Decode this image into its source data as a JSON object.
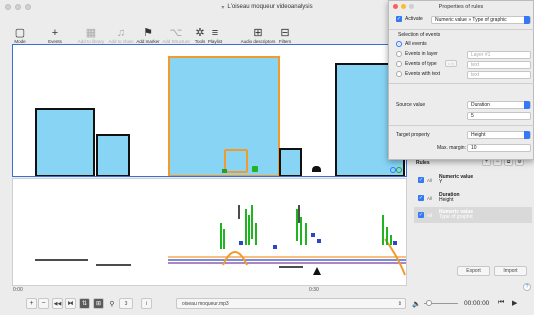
{
  "window": {
    "title": "L'oiseau moqueur videoanalysis"
  },
  "toolbar": {
    "items": [
      {
        "label": "Mode",
        "icon": "square-icon",
        "glyph": "▢",
        "enabled": true
      },
      {
        "label": "Events",
        "icon": "plus-icon",
        "glyph": "+",
        "enabled": true
      },
      {
        "label": "Add to library",
        "icon": "grid-icon",
        "glyph": "▦",
        "enabled": false
      },
      {
        "label": "Add to chain",
        "icon": "chain-icon",
        "glyph": "♫",
        "enabled": false
      },
      {
        "label": "Add marker",
        "icon": "flag-icon",
        "glyph": "⚑",
        "enabled": true
      },
      {
        "label": "Add Structure",
        "icon": "structure-icon",
        "glyph": "⌥",
        "enabled": false
      },
      {
        "label": "Tools",
        "icon": "gear-icon",
        "glyph": "✲",
        "enabled": true
      },
      {
        "label": "Playlist",
        "icon": "list-icon",
        "glyph": "≡",
        "enabled": true
      },
      {
        "label": "Audio descriptors",
        "icon": "audio-descriptors-icon",
        "glyph": "⊞",
        "enabled": true
      },
      {
        "label": "Filters",
        "icon": "filter-icon",
        "glyph": "⊟",
        "enabled": true
      }
    ]
  },
  "timeline": {
    "start_time": "0:00",
    "mid_time": "0:30"
  },
  "bottombar": {
    "zoom_out": "−",
    "zoom_in": "+",
    "page": "3",
    "info": "i",
    "file": "oiseau moqueur.mp3",
    "time": "00:00:00"
  },
  "properties_panel": {
    "title": "Properties of rules",
    "activate_label": "Activate",
    "rule_type": "Numeric value » Type of graphic",
    "selection_header": "Selection of events",
    "all_events": "All events",
    "events_in_layer": "Events in layer",
    "layer_value": "Layer #1",
    "events_of_type": "Events of type",
    "type_value": "text",
    "events_with_text": "Events with text",
    "text_value": "text",
    "source_label": "Source value",
    "source_value": "Duration",
    "source_number": "5",
    "target_label": "Target property",
    "target_value": "Height",
    "max_margin_label": "Max. margin:",
    "max_margin_value": "10"
  },
  "rules_panel": {
    "title": "Rules",
    "rules": [
      {
        "scope": "All",
        "name": "Numeric value",
        "target": "Y"
      },
      {
        "scope": "All",
        "name": "Duration",
        "target": "Height"
      },
      {
        "scope": "All",
        "name": "Numeric value",
        "target": "Type of graphic"
      }
    ],
    "export_label": "Export",
    "import_label": "Import",
    "help": "?"
  },
  "colors": {
    "accent": "#3478f6",
    "shape_fill": "#87d4f5",
    "orange": "#f29b2d"
  }
}
